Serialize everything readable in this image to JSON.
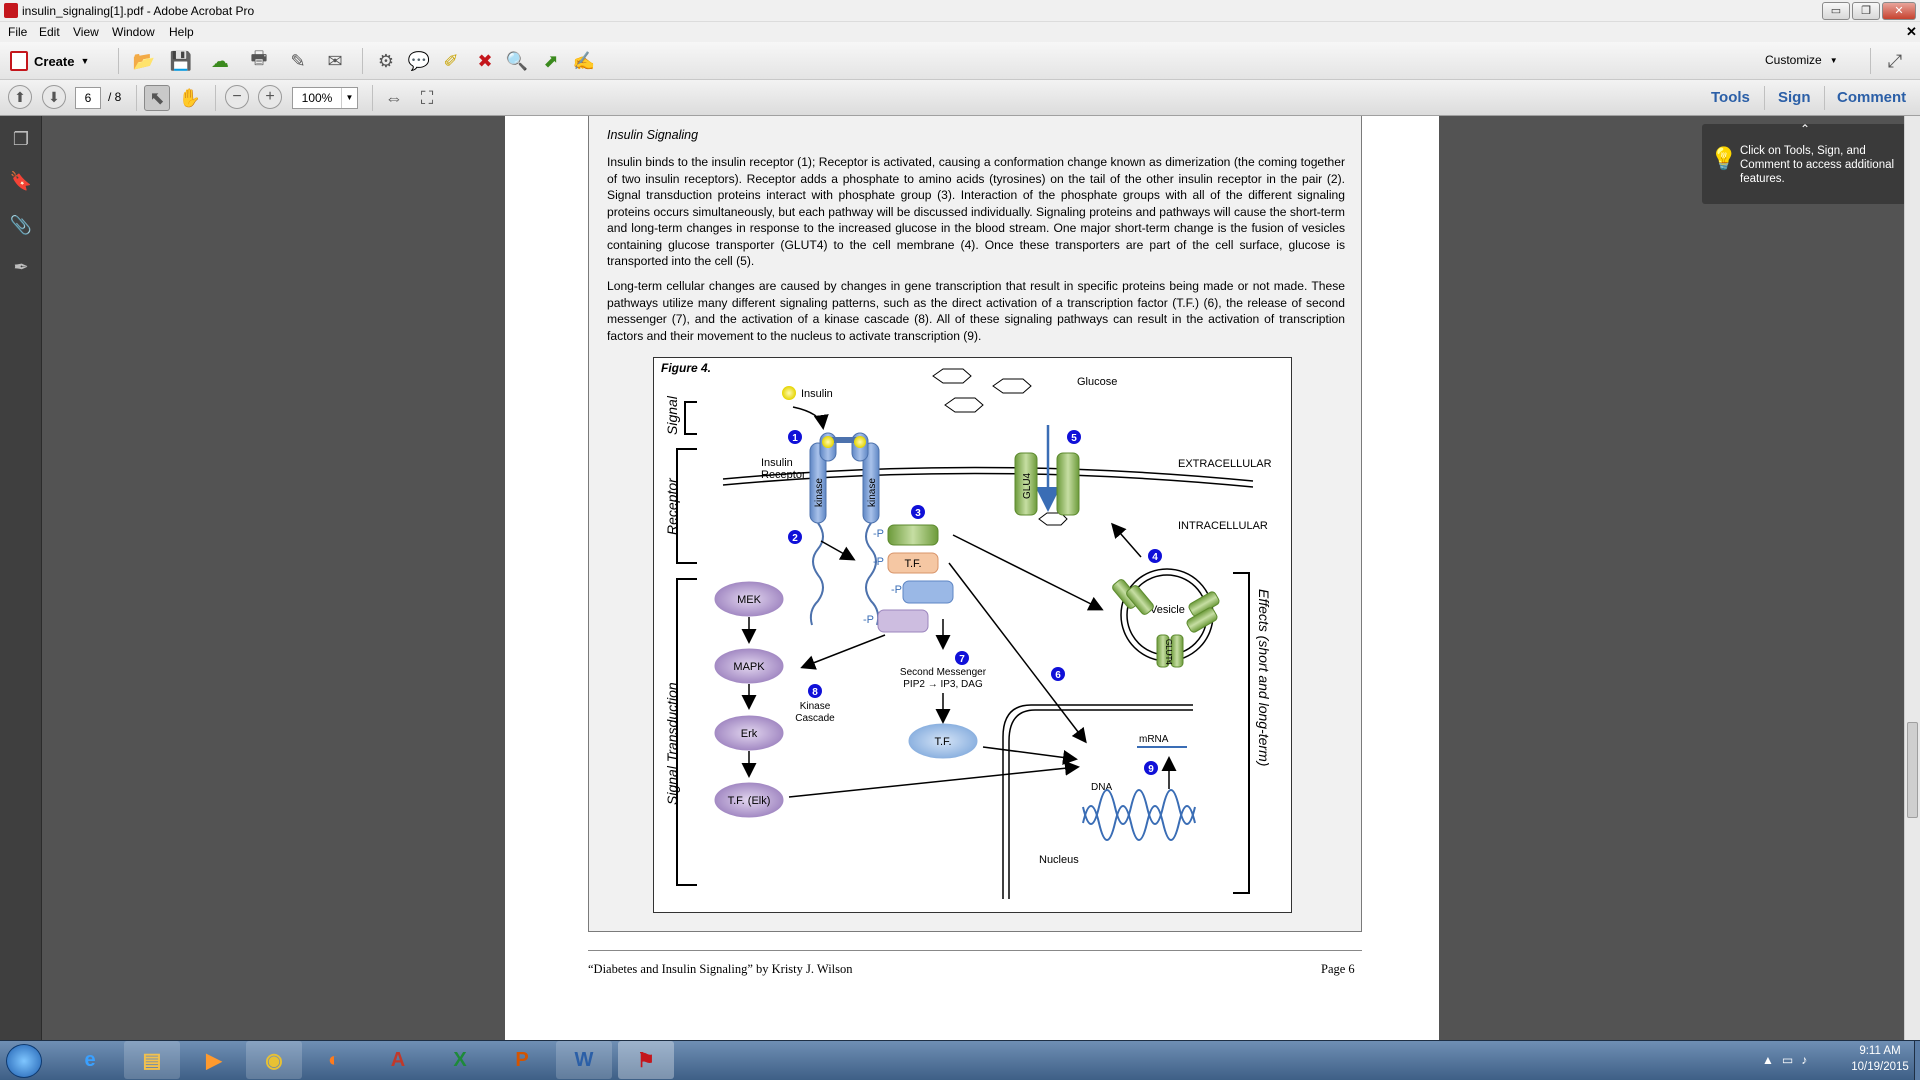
{
  "window": {
    "title": "insulin_signaling[1].pdf - Adobe Acrobat Pro",
    "minimize": "▭",
    "restore": "❐",
    "close": "✕"
  },
  "menu": [
    "File",
    "Edit",
    "View",
    "Window",
    "Help"
  ],
  "toolbar": {
    "create_label": "Create",
    "customize_label": "Customize"
  },
  "nav": {
    "page_current": "6",
    "page_total": "/ 8",
    "zoom": "100%"
  },
  "right_tabs": [
    "Tools",
    "Sign",
    "Comment"
  ],
  "tooltip": {
    "text": "Click on Tools, Sign, and Comment to access additional features."
  },
  "document": {
    "section_title": "Insulin Signaling",
    "paragraph1": "Insulin binds to the insulin receptor (1); Receptor is activated, causing a conformation change known as dimerization (the coming together of two insulin receptors). Receptor adds a phosphate to amino acids (tyrosines) on the tail of the other insulin receptor in the pair (2). Signal transduction proteins interact with phosphate group (3). Interaction of the phosphate groups with all of the different signaling proteins occurs simultaneously, but each pathway will be discussed individually. Signaling proteins and pathways will cause the short-term and long-term changes in response to the increased glucose in the blood stream. One major short-term change is the fusion of vesicles containing glucose transporter (GLUT4) to the cell membrane (4). Once these transporters are part of the cell surface, glucose is transported into the cell (5).",
    "paragraph2": "Long-term cellular changes are caused by changes in gene transcription that result in specific proteins being made or not made. These pathways utilize many different signaling patterns, such as the direct activation of a transcription factor (T.F.) (6), the release of second messenger (7), and the activation of a kinase cascade (8). All of these signaling pathways can result in the activation of transcription factors and their movement to the nucleus to activate transcription (9).",
    "footer_left": "“Diabetes and Insulin Signaling” by Kristy J. Wilson",
    "footer_right": "Page 6"
  },
  "figure": {
    "title": "Figure 4.",
    "labels": {
      "signal": "Signal",
      "receptor": "Receptor",
      "signal_transduction": "Signal Transduction",
      "effects": "Effects (short and long-term)",
      "insulin": "Insulin",
      "insulin_receptor_1": "Insulin",
      "insulin_receptor_2": "Receptor",
      "kinase": "kinase",
      "glucose": "Glucose",
      "glu4": "GLU4",
      "glut4": "GLUT4",
      "extracellular": "EXTRACELLULAR",
      "intracellular": "INTRACELLULAR",
      "vesicle": "Vesicle",
      "tf": "T.F.",
      "p": "-P",
      "mek": "MEK",
      "mapk": "MAPK",
      "erk": "Erk",
      "tf_elk": "T.F. (Elk)",
      "kinase_cascade_1": "Kinase",
      "kinase_cascade_2": "Cascade",
      "second_messenger_1": "Second Messenger",
      "second_messenger_2": "PIP2 → IP3, DAG",
      "mrna": "mRNA",
      "dna": "DNA",
      "nucleus": "Nucleus"
    },
    "steps": [
      "1",
      "2",
      "3",
      "4",
      "5",
      "6",
      "7",
      "8",
      "9"
    ]
  },
  "clock": {
    "time": "9:11 AM",
    "date": "10/19/2015"
  }
}
